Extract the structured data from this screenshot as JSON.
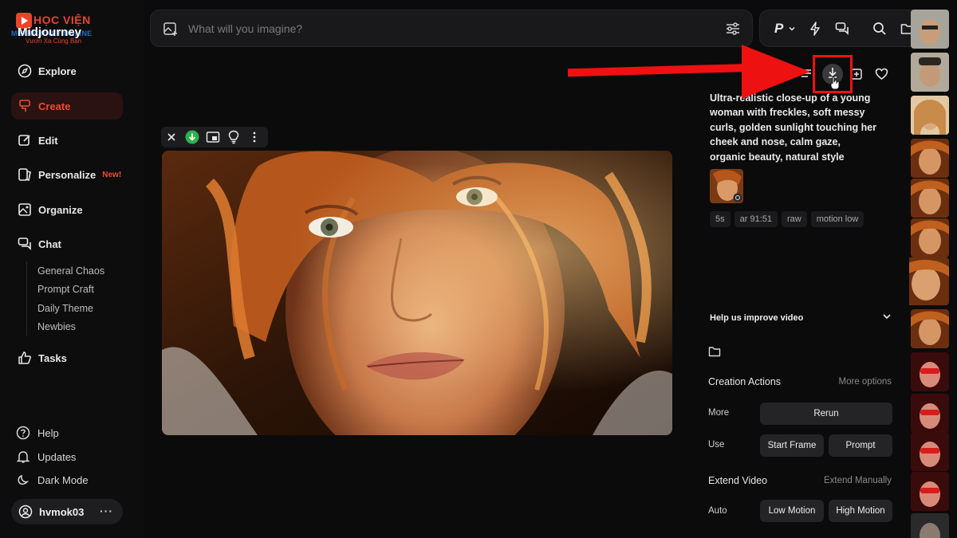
{
  "brand": {
    "hocvien": "HỌC VIỆN",
    "midjourney": "Midjourney",
    "online": "MIDJOURNEY ONLINE",
    "slogan": "Vươn Xa Cùng Bạn"
  },
  "sidebar": {
    "items": [
      {
        "label": "Explore",
        "icon": "compass-icon"
      },
      {
        "label": "Create",
        "icon": "brush-icon",
        "active": true
      },
      {
        "label": "Edit",
        "icon": "edit-icon"
      },
      {
        "label": "Personalize",
        "icon": "personalize-icon",
        "badge": "New!"
      },
      {
        "label": "Organize",
        "icon": "image-grid-icon"
      },
      {
        "label": "Chat",
        "icon": "chat-icon"
      }
    ],
    "chat_rooms": [
      "General Chaos",
      "Prompt Craft",
      "Daily Theme",
      "Newbies"
    ],
    "tasks": {
      "label": "Tasks",
      "icon": "thumbs-up-icon"
    },
    "bottom": [
      {
        "label": "Help",
        "icon": "help-icon"
      },
      {
        "label": "Updates",
        "icon": "bell-icon"
      },
      {
        "label": "Dark Mode",
        "icon": "moon-icon"
      }
    ],
    "user": {
      "name": "hvmok03",
      "more": "···"
    }
  },
  "search": {
    "placeholder": "What will you imagine?"
  },
  "toolbar": {
    "personalize_label": "P"
  },
  "panel": {
    "prompt": "Ultra-realistic close-up of a young woman with freckles, soft messy curls, golden sunlight touching her cheek and nose, calm gaze, organic beauty, natural style",
    "tags": [
      "5s",
      "ar 91:51",
      "raw",
      "motion low"
    ],
    "feedback": "Help us improve video",
    "creation_actions": {
      "title": "Creation Actions",
      "link": "More options",
      "more_label": "More",
      "rerun": "Rerun",
      "use_label": "Use",
      "start_frame": "Start Frame",
      "prompt_btn": "Prompt"
    },
    "extend_video": {
      "title": "Extend Video",
      "link": "Extend Manually",
      "auto_label": "Auto",
      "low": "Low Motion",
      "high": "High Motion"
    }
  },
  "colors": {
    "accent": "#f04a33",
    "annotation_red": "#ee1111",
    "background": "#0b0b0c"
  }
}
